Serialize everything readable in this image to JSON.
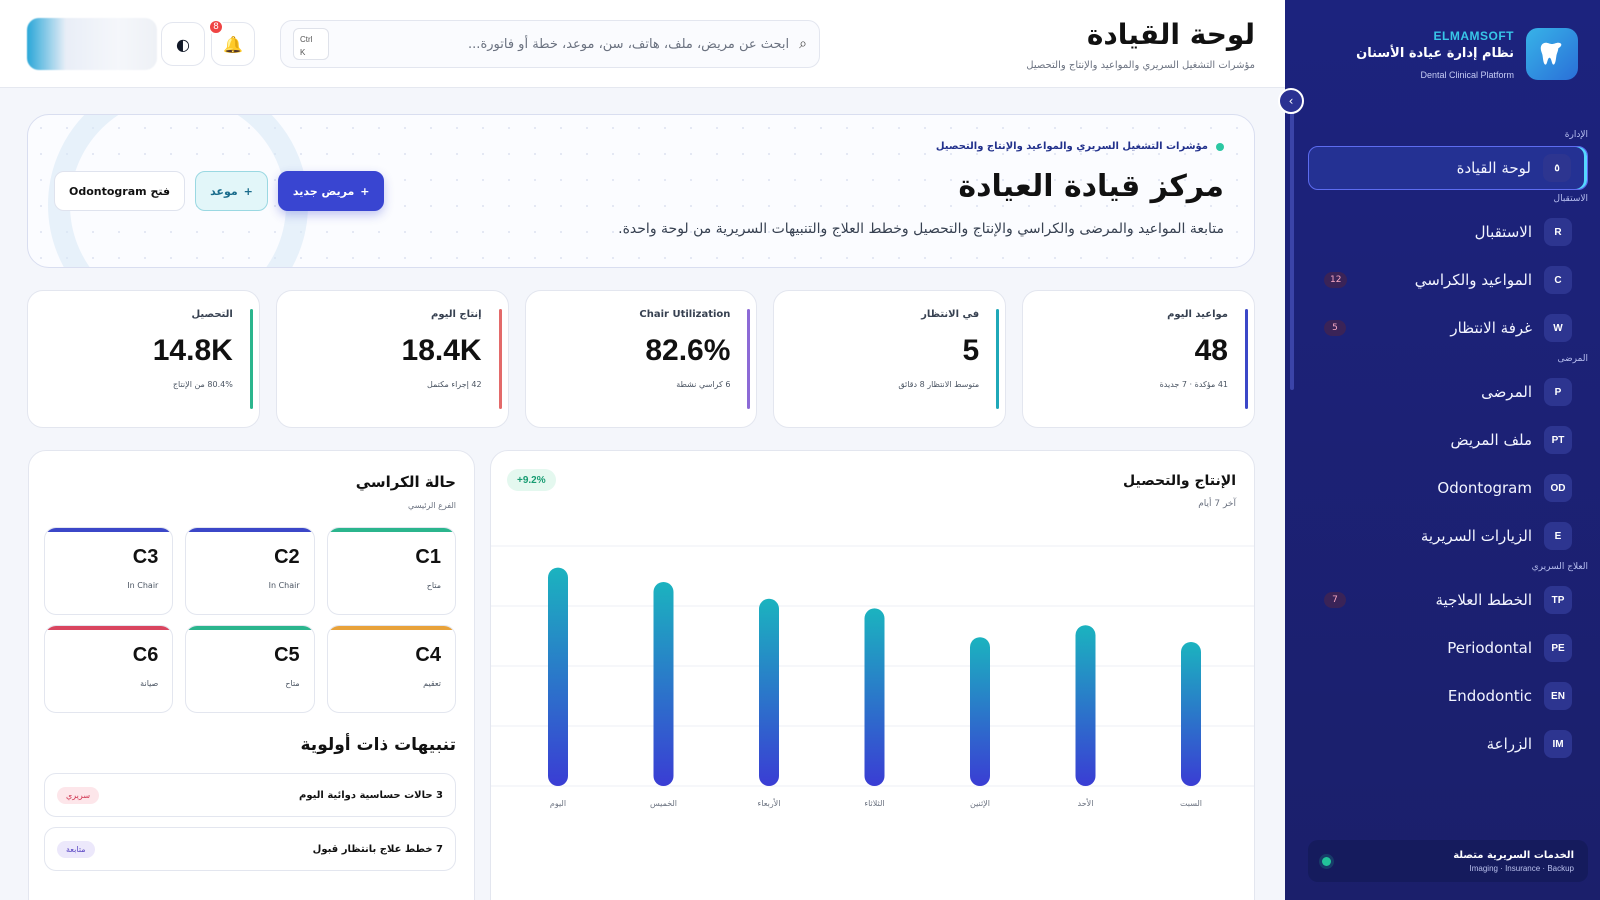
{
  "sidebar": {
    "company": "ELMAMSOFT",
    "app_name": "نظام إدارة عيادة الأسنان",
    "app_sub": "Dental Clinical Platform",
    "sections": [
      {
        "title": "الإدارة",
        "items": [
          {
            "code": "٥",
            "label": "لوحة القيادة",
            "active": true
          }
        ]
      },
      {
        "title": "الاستقبال",
        "items": [
          {
            "code": "R",
            "label": "الاستقبال"
          },
          {
            "code": "C",
            "label": "المواعيد والكراسي",
            "count": "12"
          },
          {
            "code": "W",
            "label": "غرفة الانتظار",
            "count": "5"
          }
        ]
      },
      {
        "title": "المرضى",
        "items": [
          {
            "code": "P",
            "label": "المرضى"
          },
          {
            "code": "PT",
            "label": "ملف المريض"
          },
          {
            "code": "OD",
            "label": "Odontogram"
          },
          {
            "code": "E",
            "label": "الزيارات السريرية"
          }
        ]
      },
      {
        "title": "العلاج السريري",
        "items": [
          {
            "code": "TP",
            "label": "الخطط العلاجية",
            "count": "7"
          },
          {
            "code": "PE",
            "label": "Periodontal"
          },
          {
            "code": "EN",
            "label": "Endodontic"
          },
          {
            "code": "IM",
            "label": "الزراعة"
          }
        ]
      }
    ],
    "footer": {
      "title": "الخدمات السريرية متصلة",
      "sub": "Imaging · Insurance · Backup"
    }
  },
  "topbar": {
    "title": "لوحة القيادة",
    "subtitle": "مؤشرات التشغيل السريري والمواعيد والإنتاج والتحصيل",
    "search_placeholder": "ابحث عن مريض، ملف، هاتف، سن، موعد، خطة أو فاتورة...",
    "kbd_line1": "Ctrl",
    "kbd_line2": "K",
    "notification_count": "8"
  },
  "hero": {
    "eyebrow": "مؤشرات التشغيل السريري والمواعيد والإنتاج والتحصيل",
    "title": "مركز قيادة العيادة",
    "description": "متابعة المواعيد والمرضى والكراسي والإنتاج والتحصيل وخطط العلاج والتنبيهات السريرية من لوحة واحدة.",
    "buttons": {
      "new_patient": "مريض جديد",
      "appointment": "موعد",
      "odontogram": "فتح Odontogram"
    }
  },
  "kpis": [
    {
      "label": "مواعيد اليوم",
      "value": "48",
      "sub": "41 مؤكدة · 7 جديدة",
      "color": "#3b47c8"
    },
    {
      "label": "في الانتظار",
      "value": "5",
      "sub": "متوسط الانتظار 8 دقائق",
      "color": "#1fa8b8"
    },
    {
      "label": "Chair Utilization",
      "value": "82.6%",
      "sub": "6 كراسي نشطة",
      "color": "#8c6ad6"
    },
    {
      "label": "إنتاج اليوم",
      "value": "18.4K",
      "sub": "42 إجراء مكتمل",
      "color": "#e36a6a"
    },
    {
      "label": "التحصيل",
      "value": "14.8K",
      "sub": "80.4% من الإنتاج",
      "color": "#2bb58d"
    }
  ],
  "chart_panel": {
    "title": "الإنتاج والتحصيل",
    "subtitle": "آخر 7 أيام",
    "badge": "+9.2%"
  },
  "chart_data": {
    "type": "bar",
    "categories": [
      "السبت",
      "الأحد",
      "الإثنين",
      "الثلاثاء",
      "الأربعاء",
      "الخميس",
      "اليوم"
    ],
    "values": [
      0.6,
      0.67,
      0.62,
      0.74,
      0.78,
      0.85,
      0.91
    ],
    "ylim": [
      0,
      1
    ],
    "grid": true,
    "gradient": [
      "#1bb3bf",
      "#3a3dd4"
    ]
  },
  "chairs_panel": {
    "title": "حالة الكراسي",
    "subtitle": "الفرع الرئيسي",
    "chairs": [
      {
        "code": "C1",
        "status": "متاح",
        "color": "#2bb58d"
      },
      {
        "code": "C2",
        "status": "In Chair",
        "color": "#3b47c8"
      },
      {
        "code": "C3",
        "status": "In Chair",
        "color": "#3b47c8"
      },
      {
        "code": "C4",
        "status": "تعقيم",
        "color": "#e8a23a"
      },
      {
        "code": "C5",
        "status": "متاح",
        "color": "#2bb58d"
      },
      {
        "code": "C6",
        "status": "صيانة",
        "color": "#d9455f"
      }
    ]
  },
  "alerts_panel": {
    "title": "تنبيهات ذات أولوية",
    "alerts": [
      {
        "text": "3 حالات حساسية دوائية اليوم",
        "tag": "سريري",
        "tag_bg": "#fde6ea",
        "tag_color": "#d0334f"
      },
      {
        "text": "7 خطط علاج بانتظار قبول",
        "tag": "متابعة",
        "tag_bg": "#ece8fb",
        "tag_color": "#5a47c4"
      }
    ]
  }
}
